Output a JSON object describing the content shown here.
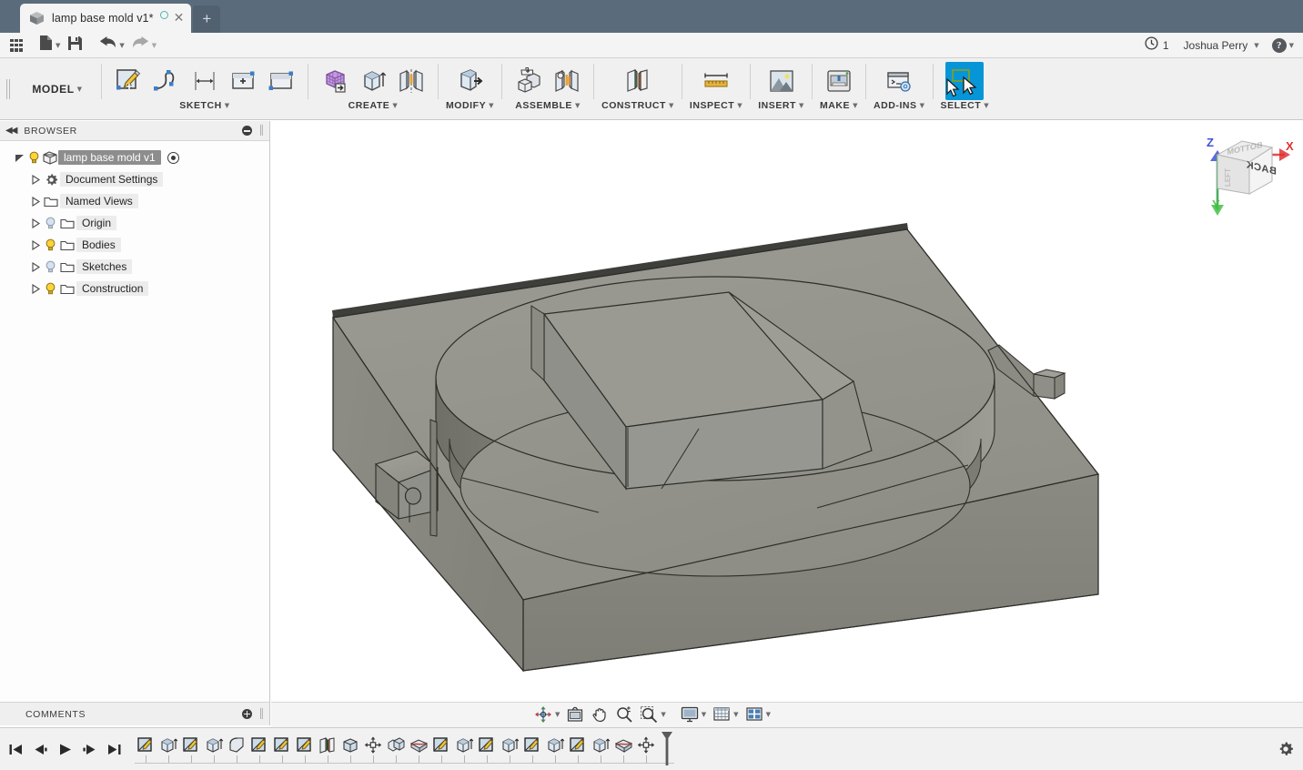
{
  "app": {
    "title_bar_color": "#5a6b7b",
    "accent_color": "#0696d7",
    "tab": {
      "label": "lamp base mold v1*",
      "cube_icon": "document-cube-icon",
      "unsaved_dot": "unsaved-indicator",
      "close_label": "✕",
      "new_tab_label": "+"
    }
  },
  "quick_access": {
    "items": [
      {
        "name": "app-grid-button",
        "icon": "grid-menu-icon",
        "caret": false
      },
      {
        "name": "new-document-button",
        "icon": "file-icon",
        "caret": true
      },
      {
        "name": "save-button",
        "icon": "floppy-disk-icon",
        "caret": false
      },
      {
        "name": "undo-button",
        "icon": "undo-arrow-icon",
        "caret": true
      },
      {
        "name": "redo-button",
        "icon": "redo-arrow-icon",
        "caret": true
      }
    ],
    "history_count": "1",
    "history_icon": "clock-icon",
    "user_name": "Joshua Perry",
    "help_label": "?"
  },
  "ribbon": {
    "workspace": "MODEL",
    "groups": [
      {
        "label": "SKETCH",
        "name": "ribbon-group-sketch",
        "buttons": [
          {
            "name": "create-sketch-button",
            "icon": "sketch-pencil-icon"
          },
          {
            "name": "spline-button",
            "icon": "spline-curve-icon"
          },
          {
            "name": "sketch-dimension-button",
            "icon": "dimension-arrow-icon"
          },
          {
            "name": "create-form-button",
            "icon": "rectangle-plus-icon"
          },
          {
            "name": "create-rectangle-button",
            "icon": "rectangle-icon"
          }
        ]
      },
      {
        "label": "CREATE",
        "name": "ribbon-group-create",
        "buttons": [
          {
            "name": "create-form-tsplines-button",
            "icon": "purple-mesh-box-icon"
          },
          {
            "name": "extrude-button",
            "icon": "extrude-box-icon"
          },
          {
            "name": "mirror-button",
            "icon": "mirror-pattern-icon"
          }
        ]
      },
      {
        "label": "MODIFY",
        "name": "ribbon-group-modify",
        "buttons": [
          {
            "name": "press-pull-button",
            "icon": "press-pull-icon"
          }
        ]
      },
      {
        "label": "ASSEMBLE",
        "name": "ribbon-group-assemble",
        "buttons": [
          {
            "name": "new-component-button",
            "icon": "component-plus-icon"
          },
          {
            "name": "joint-button",
            "icon": "joint-icon"
          }
        ]
      },
      {
        "label": "CONSTRUCT",
        "name": "ribbon-group-construct",
        "buttons": [
          {
            "name": "offset-plane-button",
            "icon": "offset-plane-icon"
          }
        ]
      },
      {
        "label": "INSPECT",
        "name": "ribbon-group-inspect",
        "buttons": [
          {
            "name": "measure-button",
            "icon": "ruler-icon"
          }
        ]
      },
      {
        "label": "INSERT",
        "name": "ribbon-group-insert",
        "buttons": [
          {
            "name": "insert-image-button",
            "icon": "landscape-image-icon"
          }
        ]
      },
      {
        "label": "MAKE",
        "name": "ribbon-group-make",
        "buttons": [
          {
            "name": "3d-print-button",
            "icon": "3d-printer-icon"
          }
        ]
      },
      {
        "label": "ADD-INS",
        "name": "ribbon-group-addins",
        "buttons": [
          {
            "name": "scripts-addins-button",
            "icon": "script-console-icon"
          }
        ]
      },
      {
        "label": "SELECT",
        "name": "ribbon-group-select",
        "active": true,
        "buttons": [
          {
            "name": "select-tool-button",
            "icon": "selection-cursor-icon",
            "active": true
          }
        ]
      }
    ]
  },
  "browser": {
    "header": {
      "title": "BROWSER",
      "collapse_icon": "collapse-left-icon",
      "minimize_icon": "minus-circle-icon"
    },
    "root": {
      "label": "lamp base mold v1",
      "bulb": "on",
      "cube_icon": "component-cube-icon",
      "target_icon": "activate-component-icon"
    },
    "items": [
      {
        "label": "Document Settings",
        "icon": "gear-icon",
        "bulb": "none",
        "name": "browser-item-document-settings"
      },
      {
        "label": "Named Views",
        "icon": "folder-icon",
        "bulb": "none",
        "name": "browser-item-named-views"
      },
      {
        "label": "Origin",
        "icon": "folder-icon",
        "bulb": "off",
        "name": "browser-item-origin"
      },
      {
        "label": "Bodies",
        "icon": "folder-icon",
        "bulb": "on",
        "name": "browser-item-bodies"
      },
      {
        "label": "Sketches",
        "icon": "folder-icon",
        "bulb": "off",
        "name": "browser-item-sketches"
      },
      {
        "label": "Construction",
        "icon": "folder-icon",
        "bulb": "on",
        "name": "browser-item-construction"
      }
    ]
  },
  "canvas": {
    "model_name": "lamp-base-mold-3d-model",
    "background": "#ffffff",
    "viewcube": {
      "face_label": "BACK",
      "axis_x": "X",
      "axis_y": "Y",
      "axis_z": "Z",
      "color_x": "#e03030",
      "color_y": "#45c045",
      "color_z": "#4050d8"
    }
  },
  "comments": {
    "title": "COMMENTS",
    "add_icon": "plus-circle-icon"
  },
  "navbar": {
    "buttons": [
      {
        "name": "orbit-button",
        "icon": "orbit-icon",
        "caret": true
      },
      {
        "name": "look-at-button",
        "icon": "look-at-icon",
        "caret": false
      },
      {
        "name": "pan-button",
        "icon": "hand-pan-icon",
        "caret": false
      },
      {
        "name": "zoom-button",
        "icon": "magnifier-zoom-icon",
        "caret": false
      },
      {
        "name": "zoom-window-button",
        "icon": "zoom-window-icon",
        "caret": true
      },
      {
        "name": "display-settings-button",
        "icon": "monitor-display-icon",
        "caret": true
      },
      {
        "name": "grid-snaps-button",
        "icon": "grid-snap-icon",
        "caret": true
      },
      {
        "name": "viewport-layout-button",
        "icon": "viewport-layout-icon",
        "caret": true
      }
    ]
  },
  "timeline": {
    "controls": [
      {
        "name": "timeline-go-start-button",
        "icon": "skip-to-start-icon"
      },
      {
        "name": "timeline-step-back-button",
        "icon": "step-backward-icon"
      },
      {
        "name": "timeline-play-button",
        "icon": "play-icon"
      },
      {
        "name": "timeline-step-forward-button",
        "icon": "step-forward-icon"
      },
      {
        "name": "timeline-go-end-button",
        "icon": "skip-to-end-icon"
      }
    ],
    "features": [
      {
        "name": "timeline-feature-sketch",
        "icon": "sketch-feature-icon"
      },
      {
        "name": "timeline-feature-extrude",
        "icon": "extrude-feature-icon"
      },
      {
        "name": "timeline-feature-sketch",
        "icon": "sketch-feature-icon"
      },
      {
        "name": "timeline-feature-extrude",
        "icon": "extrude-feature-icon"
      },
      {
        "name": "timeline-feature-fillet",
        "icon": "fillet-feature-icon"
      },
      {
        "name": "timeline-feature-sketch",
        "icon": "sketch-feature-icon"
      },
      {
        "name": "timeline-feature-sketch",
        "icon": "sketch-feature-icon"
      },
      {
        "name": "timeline-feature-sketch",
        "icon": "sketch-feature-icon"
      },
      {
        "name": "timeline-feature-plane",
        "icon": "construct-plane-icon"
      },
      {
        "name": "timeline-feature-body",
        "icon": "body-feature-icon"
      },
      {
        "name": "timeline-feature-move",
        "icon": "move-feature-icon"
      },
      {
        "name": "timeline-feature-combine",
        "icon": "combine-feature-icon"
      },
      {
        "name": "timeline-feature-split",
        "icon": "split-face-icon"
      },
      {
        "name": "timeline-feature-sketch",
        "icon": "sketch-feature-icon"
      },
      {
        "name": "timeline-feature-extrude",
        "icon": "extrude-feature-icon"
      },
      {
        "name": "timeline-feature-sketch",
        "icon": "sketch-feature-icon"
      },
      {
        "name": "timeline-feature-extrude",
        "icon": "extrude-feature-icon"
      },
      {
        "name": "timeline-feature-sketch",
        "icon": "sketch-feature-icon"
      },
      {
        "name": "timeline-feature-extrude",
        "icon": "extrude-feature-icon"
      },
      {
        "name": "timeline-feature-sketch",
        "icon": "sketch-feature-icon"
      },
      {
        "name": "timeline-feature-extrude",
        "icon": "extrude-feature-icon"
      },
      {
        "name": "timeline-feature-split",
        "icon": "split-face-icon"
      },
      {
        "name": "timeline-feature-move",
        "icon": "move-feature-icon"
      }
    ],
    "marker_name": "timeline-end-marker",
    "settings_icon": "gear-icon"
  }
}
